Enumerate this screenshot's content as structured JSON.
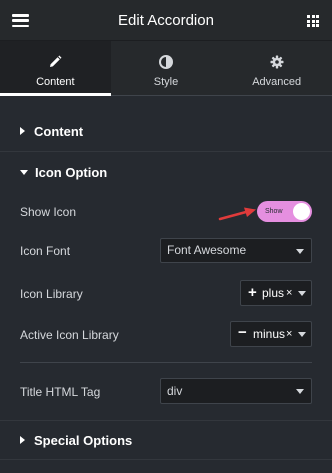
{
  "header": {
    "title": "Edit Accordion",
    "menu_icon": "hamburger-icon",
    "apps_icon": "grid-icon"
  },
  "tabs": [
    {
      "label": "Content",
      "icon": "pencil-icon",
      "active": true
    },
    {
      "label": "Style",
      "icon": "half-circle-icon",
      "active": false
    },
    {
      "label": "Advanced",
      "icon": "gear-icon",
      "active": false
    }
  ],
  "sections": {
    "content": {
      "title": "Content",
      "expanded": false
    },
    "icon_option": {
      "title": "Icon Option",
      "expanded": true
    },
    "special_options": {
      "title": "Special Options",
      "expanded": false
    }
  },
  "fields": {
    "show_icon": {
      "label": "Show Icon",
      "toggle_text": "Show",
      "value": true
    },
    "icon_font": {
      "label": "Icon Font",
      "value": "Font Awesome"
    },
    "icon_library": {
      "label": "Icon Library",
      "value": "plus",
      "remove": "×"
    },
    "active_icon_library": {
      "label": "Active Icon Library",
      "value": "minus",
      "remove": "×"
    },
    "title_html_tag": {
      "label": "Title HTML Tag",
      "value": "div"
    }
  },
  "colors": {
    "panel_bg": "#262a30",
    "toggle_on": "#e58fe0",
    "arrow_annotation": "#e03b3b"
  }
}
